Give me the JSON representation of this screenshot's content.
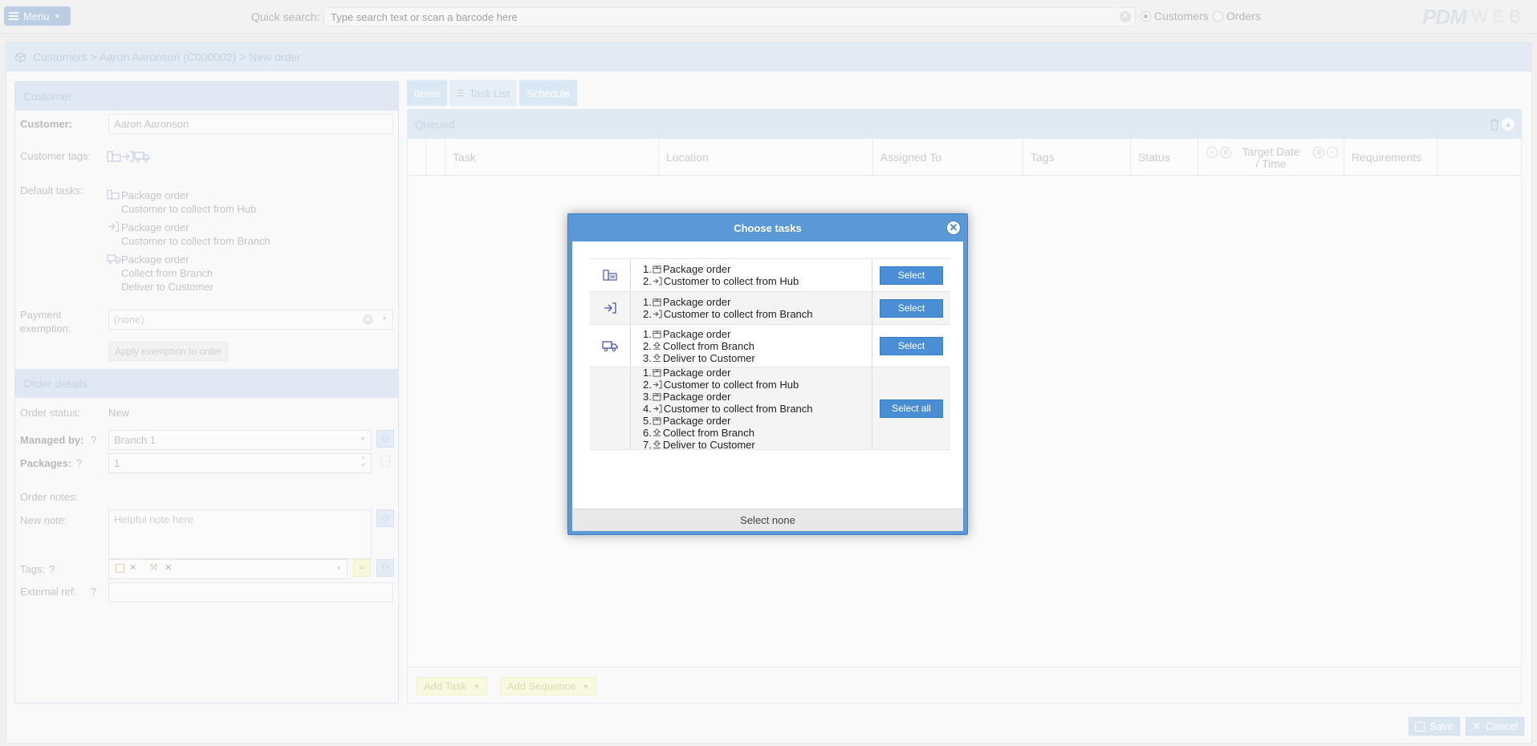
{
  "topbar": {
    "menu_label": "Menu",
    "quick_search_label": "Quick search:",
    "quick_search_placeholder": "Type search text or scan a barcode here",
    "radio_customers": "Customers",
    "radio_orders": "Orders",
    "logo_pdm": "PDM",
    "logo_web": "WEB"
  },
  "breadcrumb": "Customers > Aaron Aaronson (C000002) > New order",
  "customer_section": {
    "title": "Customer",
    "customer_label": "Customer:",
    "customer_value": "Aaron Aaronson",
    "tags_label": "Customer tags:",
    "default_tasks_label": "Default tasks:",
    "default_tasks": [
      {
        "icon": "hub-icon",
        "lines": [
          "Package order",
          "Customer to collect from Hub"
        ]
      },
      {
        "icon": "branch-icon",
        "lines": [
          "Package order",
          "Customer to collect from Branch"
        ]
      },
      {
        "icon": "truck-icon",
        "lines": [
          "Package order",
          "Collect from Branch",
          "Deliver to Customer"
        ]
      }
    ],
    "payment_label": "Payment exemption:",
    "payment_value": "(none)",
    "apply_btn": "Apply exemption to order"
  },
  "order_section": {
    "title": "Order details",
    "status_label": "Order status:",
    "status_value": "New",
    "managed_label": "Managed by:",
    "managed_value": "Branch 1",
    "packages_label": "Packages:",
    "packages_value": "1",
    "notes_label": "Order notes:",
    "new_note_label": "New note:",
    "new_note_placeholder": "Helpful note here",
    "tags_label": "Tags:",
    "ext_ref_label": "External ref:",
    "help_mark": "?"
  },
  "tabs": [
    "Items",
    "Task List",
    "Schedule"
  ],
  "grid": {
    "section_title": "Queued",
    "columns": [
      "Task",
      "Location",
      "Assigned To",
      "Tags",
      "Status",
      "Target Date / Time",
      "Requirements"
    ],
    "target_date_line1": "Target Date",
    "target_date_line2": "/ Time",
    "add_task": "Add Task",
    "add_sequence": "Add Sequence"
  },
  "footer": {
    "save": "Save",
    "cancel": "Cancel"
  },
  "dialog": {
    "title": "Choose tasks",
    "rows": [
      {
        "icon": "hub-icon",
        "button": "Select",
        "steps": [
          {
            "n": "1.",
            "icon": "package-icon",
            "text": "Package order"
          },
          {
            "n": "2.",
            "icon": "handover-icon",
            "text": "Customer to collect from Hub"
          }
        ]
      },
      {
        "icon": "branch-icon",
        "button": "Select",
        "steps": [
          {
            "n": "1.",
            "icon": "package-icon",
            "text": "Package order"
          },
          {
            "n": "2.",
            "icon": "handover-icon",
            "text": "Customer to collect from Branch"
          }
        ]
      },
      {
        "icon": "truck-icon",
        "button": "Select",
        "steps": [
          {
            "n": "1.",
            "icon": "package-icon",
            "text": "Package order"
          },
          {
            "n": "2.",
            "icon": "collect-icon",
            "text": "Collect from Branch"
          },
          {
            "n": "3.",
            "icon": "deliver-icon",
            "text": "Deliver to Customer"
          }
        ]
      },
      {
        "icon": "",
        "button": "Select all",
        "steps": [
          {
            "n": "1.",
            "icon": "package-icon",
            "text": "Package order"
          },
          {
            "n": "2.",
            "icon": "handover-icon",
            "text": "Customer to collect from Hub"
          },
          {
            "n": "3.",
            "icon": "package-icon",
            "text": "Package order"
          },
          {
            "n": "4.",
            "icon": "handover-icon",
            "text": "Customer to collect from Branch"
          },
          {
            "n": "5.",
            "icon": "package-icon",
            "text": "Package order"
          },
          {
            "n": "6.",
            "icon": "collect-icon",
            "text": "Collect from Branch"
          },
          {
            "n": "7.",
            "icon": "deliver-icon",
            "text": "Deliver to Customer"
          }
        ]
      }
    ],
    "select_none": "Select none"
  },
  "colors": {
    "accent": "#5b98d6",
    "button": "#4a8fd6",
    "section_bg": "#d1dfee"
  }
}
